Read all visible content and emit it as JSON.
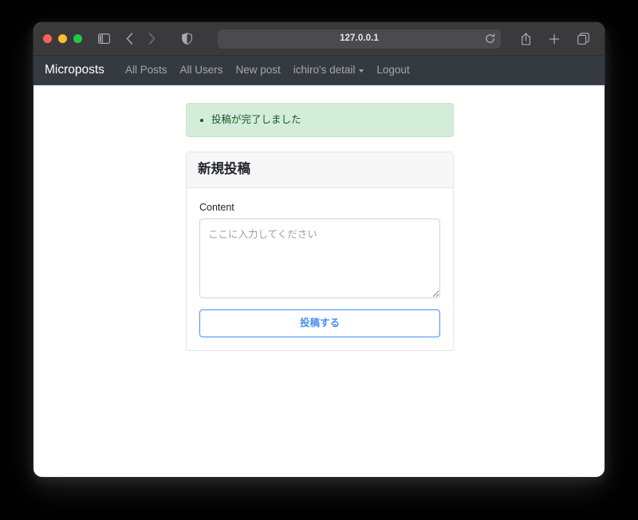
{
  "browser": {
    "url": "127.0.0.1",
    "traffic_lights": [
      {
        "name": "close-button",
        "color": "#ff5f57"
      },
      {
        "name": "minimize-button",
        "color": "#febc2e"
      },
      {
        "name": "maximize-button",
        "color": "#28c840"
      }
    ],
    "toolbar_icons": [
      "sidebar-toggle-icon",
      "back-arrow-icon",
      "forward-arrow-icon",
      "privacy-shield-icon",
      "reload-icon",
      "share-icon",
      "new-tab-icon",
      "tab-overview-icon"
    ]
  },
  "navbar": {
    "brand": "Microposts",
    "links": [
      {
        "label": "All Posts",
        "has_caret": false
      },
      {
        "label": "All Users",
        "has_caret": false
      },
      {
        "label": "New post",
        "has_caret": false
      },
      {
        "label": "ichiro's detail",
        "has_caret": true
      },
      {
        "label": "Logout",
        "has_caret": false
      }
    ]
  },
  "alert": {
    "type": "success",
    "background_color": "#d4edda",
    "border_color": "#c3e6cb",
    "text_color": "#155724",
    "messages": [
      "投稿が完了しました"
    ]
  },
  "card": {
    "title": "新規投稿",
    "form": {
      "content_label": "Content",
      "content_value": "",
      "content_placeholder": "ここに入力してください",
      "submit_label": "投稿する",
      "submit_color": "#4a90f0"
    }
  }
}
